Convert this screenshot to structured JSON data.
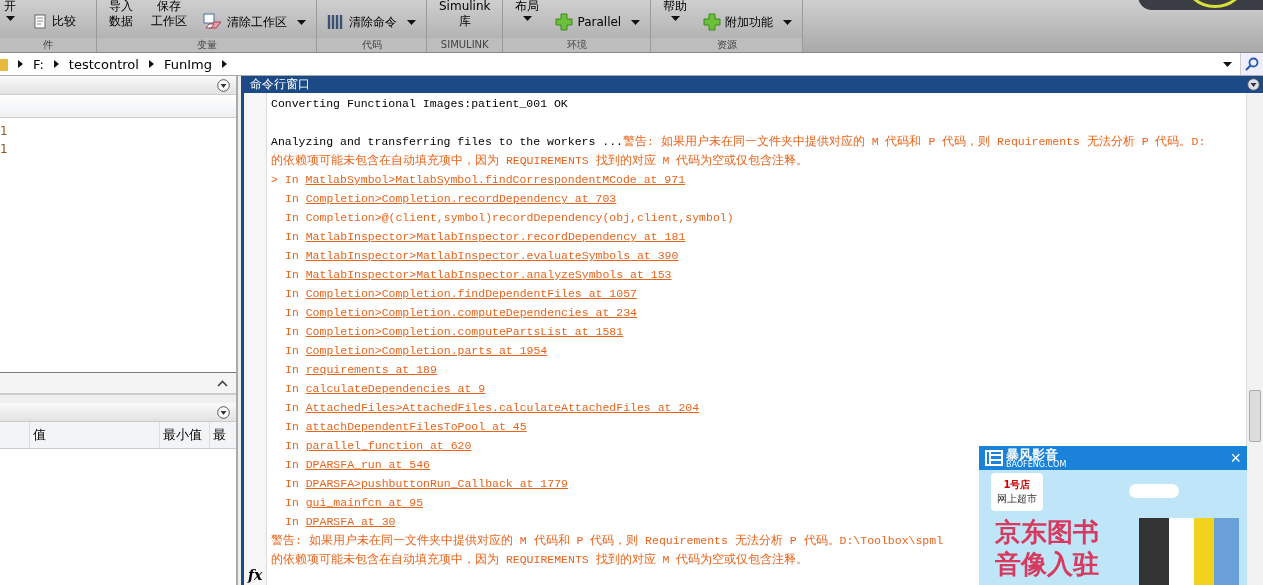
{
  "toolstrip": {
    "groups": [
      {
        "label": "件",
        "items": [
          {
            "kind": "large",
            "lines": [
              "开"
            ],
            "caret": true
          },
          {
            "kind": "small",
            "label": "比较",
            "caret": false
          }
        ]
      },
      {
        "label": "变量",
        "items": [
          {
            "kind": "large",
            "lines": [
              "导入",
              "数据"
            ],
            "caret": false
          },
          {
            "kind": "large",
            "lines": [
              "保存",
              "工作区"
            ],
            "caret": false
          },
          {
            "kind": "small",
            "label": "清除工作区",
            "caret": true
          }
        ]
      },
      {
        "label": "代码",
        "items": [
          {
            "kind": "small",
            "label": "清除命令",
            "caret": true
          }
        ]
      },
      {
        "label": "SIMULINK",
        "items": [
          {
            "kind": "large",
            "lines": [
              "Simulink",
              "库"
            ],
            "caret": false
          }
        ]
      },
      {
        "label": "环境",
        "items": [
          {
            "kind": "large",
            "lines": [
              "布局"
            ],
            "caret": true
          },
          {
            "kind": "small",
            "label": "Parallel",
            "caret": true
          }
        ]
      },
      {
        "label": "资源",
        "items": [
          {
            "kind": "large",
            "lines": [
              "帮助"
            ],
            "caret": true
          },
          {
            "kind": "small",
            "label": "附加功能",
            "caret": true
          }
        ]
      }
    ]
  },
  "address_bar": {
    "path": [
      "F:",
      "testcontrol",
      "FunImg"
    ]
  },
  "left_panel": {
    "top_rows": [
      "1",
      "1"
    ],
    "table_columns": [
      "",
      "值",
      "最小值",
      "最"
    ]
  },
  "command_window": {
    "title": "命令行窗口",
    "lines": [
      {
        "kind": "plain",
        "text": "Converting Functional Images:patient_001 OK"
      },
      {
        "kind": "blank"
      },
      {
        "kind": "mixed",
        "text": "Analyzing and transferring files to the workers ...",
        "warning": "警告: 如果用户未在同一文件夹中提供对应的 M 代码和 P 代码，则 Requirements 无法分析 P 代码。D:"
      },
      {
        "kind": "warning",
        "text": "的依赖项可能未包含在自动填充项中，因为 REQUIREMENTS 找到的对应 M 代码为空或仅包含注释。"
      },
      {
        "kind": "stack",
        "marker": ">",
        "prefix": "In",
        "link": "MatlabSymbol>MatlabSymbol.findCorrespondentMCode at 971"
      },
      {
        "kind": "stack",
        "prefix": "In",
        "link": "Completion>Completion.recordDependency at 703"
      },
      {
        "kind": "stack",
        "prefix": "In",
        "text": "Completion>@(client,symbol)recordDependency(obj,client,symbol)"
      },
      {
        "kind": "stack",
        "prefix": "In",
        "link": "MatlabInspector>MatlabInspector.recordDependency at 181"
      },
      {
        "kind": "stack",
        "prefix": "In",
        "link": "MatlabInspector>MatlabInspector.evaluateSymbols at 390"
      },
      {
        "kind": "stack",
        "prefix": "In",
        "link": "MatlabInspector>MatlabInspector.analyzeSymbols at 153"
      },
      {
        "kind": "stack",
        "prefix": "In",
        "link": "Completion>Completion.findDependentFiles at 1057"
      },
      {
        "kind": "stack",
        "prefix": "In",
        "link": "Completion>Completion.computeDependencies at 234"
      },
      {
        "kind": "stack",
        "prefix": "In",
        "link": "Completion>Completion.computePartsList at 1581"
      },
      {
        "kind": "stack",
        "prefix": "In",
        "link": "Completion>Completion.parts at 1954"
      },
      {
        "kind": "stack",
        "prefix": "In",
        "link": "requirements at 189"
      },
      {
        "kind": "stack",
        "prefix": "In",
        "link": "calculateDependencies at 9"
      },
      {
        "kind": "stack",
        "prefix": "In",
        "link": "AttachedFiles>AttachedFiles.calculateAttachedFiles at 204"
      },
      {
        "kind": "stack",
        "prefix": "In",
        "link": "attachDependentFilesToPool at 45"
      },
      {
        "kind": "stack",
        "prefix": "In",
        "link": "parallel_function at 620"
      },
      {
        "kind": "stack",
        "prefix": "In",
        "link": "DPARSFA_run at 546"
      },
      {
        "kind": "stack",
        "prefix": "In",
        "link": "DPARSFA>pushbuttonRun_Callback at 1779"
      },
      {
        "kind": "stack",
        "prefix": "In",
        "link": "gui_mainfcn at 95"
      },
      {
        "kind": "stack",
        "prefix": "In",
        "link": "DPARSFA at 30"
      },
      {
        "kind": "warning",
        "text": "警告: 如果用户未在同一文件夹中提供对应的 M 代码和 P 代码，则 Requirements 无法分析 P 代码。D:\\Toolbox\\spml"
      },
      {
        "kind": "warning",
        "text": "的依赖项可能未包含在自动填充项中，因为 REQUIREMENTS 找到的对应 M 代码为空或仅包含注释。"
      }
    ],
    "prompt": "fx"
  },
  "ad_popup": {
    "logo": "暴风影音",
    "logo_sub": "BAOFENG.COM",
    "close": "×",
    "store_logo": "1号店",
    "store_sub": "网上超市",
    "headline": [
      "京东图书",
      "音像入驻"
    ]
  }
}
